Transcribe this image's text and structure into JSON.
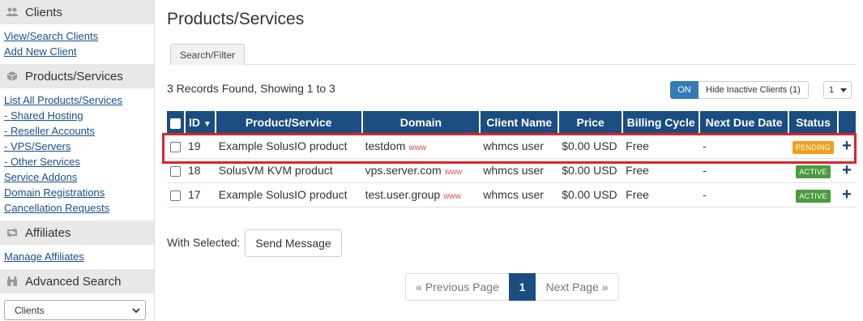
{
  "sidebar": {
    "clients_heading": "Clients",
    "clients_links": [
      "View/Search Clients",
      "Add New Client"
    ],
    "products_heading": "Products/Services",
    "products_links": [
      "List All Products/Services",
      "- Shared Hosting",
      "- Reseller Accounts",
      "- VPS/Servers",
      "- Other Services",
      "Service Addons",
      "Domain Registrations",
      "Cancellation Requests"
    ],
    "affiliates_heading": "Affiliates",
    "affiliates_links": [
      "Manage Affiliates"
    ],
    "advanced_heading": "Advanced Search",
    "advanced_select": "Clients"
  },
  "main": {
    "title": "Products/Services",
    "tab": "Search/Filter",
    "records": "3 Records Found, Showing 1 to 3",
    "toggle_on": "ON",
    "toggle_label": "Hide Inactive Clients (1)",
    "per_page": "1",
    "columns": [
      "ID",
      "Product/Service",
      "Domain",
      "Client Name",
      "Price",
      "Billing Cycle",
      "Next Due Date",
      "Status"
    ],
    "www_label": "www",
    "rows": [
      {
        "id": "19",
        "product": "Example SolusIO product",
        "domain": "testdom",
        "client": "whmcs user",
        "price": "$0.00 USD",
        "cycle": "Free",
        "due": "-",
        "status": "PENDING"
      },
      {
        "id": "18",
        "product": "SolusVM KVM product",
        "domain": "vps.server.com",
        "client": "whmcs user",
        "price": "$0.00 USD",
        "cycle": "Free",
        "due": "-",
        "status": "ACTIVE"
      },
      {
        "id": "17",
        "product": "Example SolusIO product",
        "domain": "test.user.group",
        "client": "whmcs user",
        "price": "$0.00 USD",
        "cycle": "Free",
        "due": "-",
        "status": "ACTIVE"
      }
    ],
    "with_selected": "With Selected:",
    "send_message": "Send Message",
    "pager": {
      "prev": "« Previous Page",
      "current": "1",
      "next": "Next Page »"
    }
  },
  "colors": {
    "header_blue": "#1a4d80",
    "pending": "#f0a11e",
    "active": "#4a9c3d",
    "highlight": "#d9262c"
  },
  "icons": {
    "clients": "users-icon",
    "products": "box-icon",
    "affiliates": "retweet-icon",
    "advanced": "binoculars-icon"
  }
}
